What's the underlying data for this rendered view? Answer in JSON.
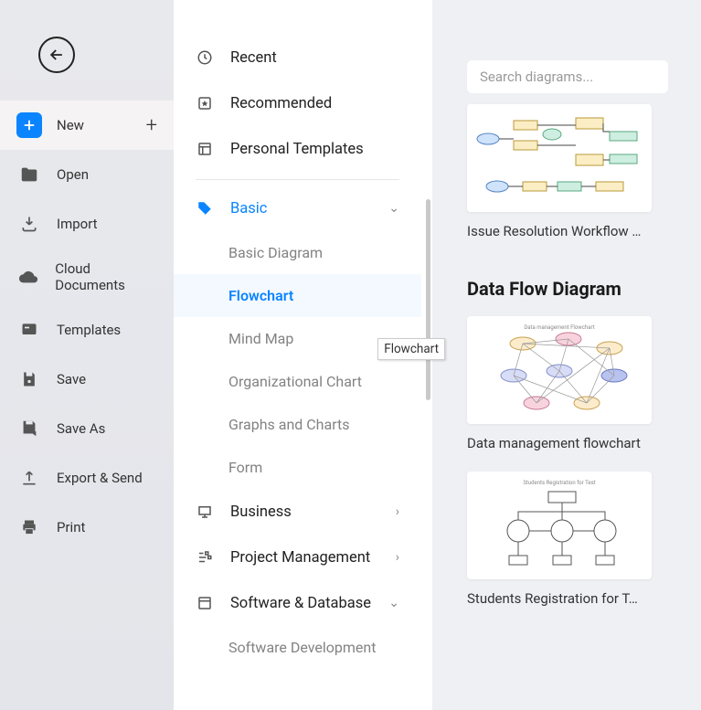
{
  "left_sidebar": {
    "items": [
      {
        "label": "New",
        "icon": "plus",
        "active": true
      },
      {
        "label": "Open",
        "icon": "folder"
      },
      {
        "label": "Import",
        "icon": "download"
      },
      {
        "label": "Cloud Documents",
        "icon": "cloud"
      },
      {
        "label": "Templates",
        "icon": "chat"
      },
      {
        "label": "Save",
        "icon": "save"
      },
      {
        "label": "Save As",
        "icon": "saveas"
      },
      {
        "label": "Export & Send",
        "icon": "upload"
      },
      {
        "label": "Print",
        "icon": "print"
      }
    ]
  },
  "categories": {
    "top": [
      {
        "label": "Recent"
      },
      {
        "label": "Recommended"
      },
      {
        "label": "Personal Templates"
      }
    ],
    "groups": [
      {
        "label": "Basic",
        "icon": "tag",
        "expanded": true,
        "active": true,
        "subs": [
          "Basic Diagram",
          "Flowchart",
          "Mind Map",
          "Organizational Chart",
          "Graphs and Charts",
          "Form"
        ],
        "selected": "Flowchart"
      },
      {
        "label": "Business",
        "icon": "presentation",
        "expanded": false
      },
      {
        "label": "Project Management",
        "icon": "pm",
        "expanded": false
      },
      {
        "label": "Software & Database",
        "icon": "db",
        "expanded": true,
        "subs": [
          "Software Development"
        ]
      }
    ]
  },
  "tooltip": "Flowchart",
  "search": {
    "placeholder": "Search diagrams..."
  },
  "right": {
    "first_card": "Issue Resolution Workflow …",
    "section_title": "Data Flow Diagram",
    "cards": [
      {
        "label": "Data management flowchart"
      },
      {
        "label": "Students Registration for T…"
      }
    ]
  }
}
